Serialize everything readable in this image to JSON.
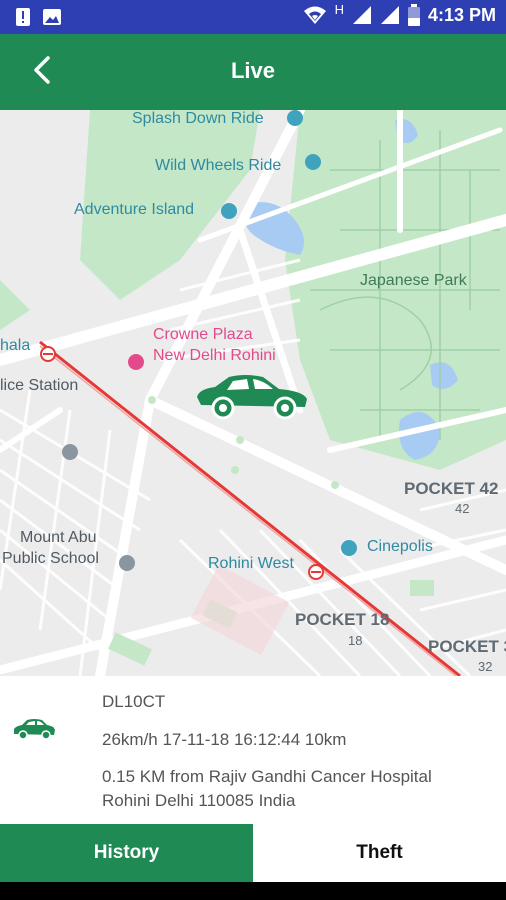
{
  "status_bar": {
    "time": "4:13 PM",
    "network": "H",
    "icons": [
      "alert-icon",
      "image-icon",
      "wifi-icon",
      "signal-icon",
      "signal-icon",
      "battery-icon"
    ]
  },
  "app_bar": {
    "title": "Live",
    "back_icon": "back-arrow-icon"
  },
  "map": {
    "labels": {
      "splash": "Splash Down Ride",
      "wild": "Wild Wheels Ride",
      "adventure": "Adventure Island",
      "japanese": "Japanese Park",
      "hala": "hala",
      "crowne1": "Crowne Plaza",
      "crowne2": "New Delhi Rohini",
      "police": "lice Station",
      "pocket42": "POCKET 42",
      "n42": "42",
      "mountabu1": "Mount Abu",
      "mountabu2": "Public School",
      "cinepolis": "Cinepolis",
      "rohiniwest": "Rohini West",
      "pocket18": "POCKET 18",
      "n18": "18",
      "pocket3": "POCKET 3",
      "n32": "32"
    },
    "colors": {
      "park": "#c4e8c7",
      "water": "#a8cbf3",
      "road": "#ffffff",
      "metro": "#e53935",
      "car": "#1f8a53"
    }
  },
  "vehicle": {
    "number": "DL10CT",
    "speed_line": "26km/h  17-11-18 16:12:44  10km",
    "address_line1": "0.15 KM from Rajiv Gandhi Cancer Hospital",
    "address_line2": "Rohini  Delhi  110085  India"
  },
  "tabs": {
    "history": "History",
    "theft": "Theft"
  }
}
